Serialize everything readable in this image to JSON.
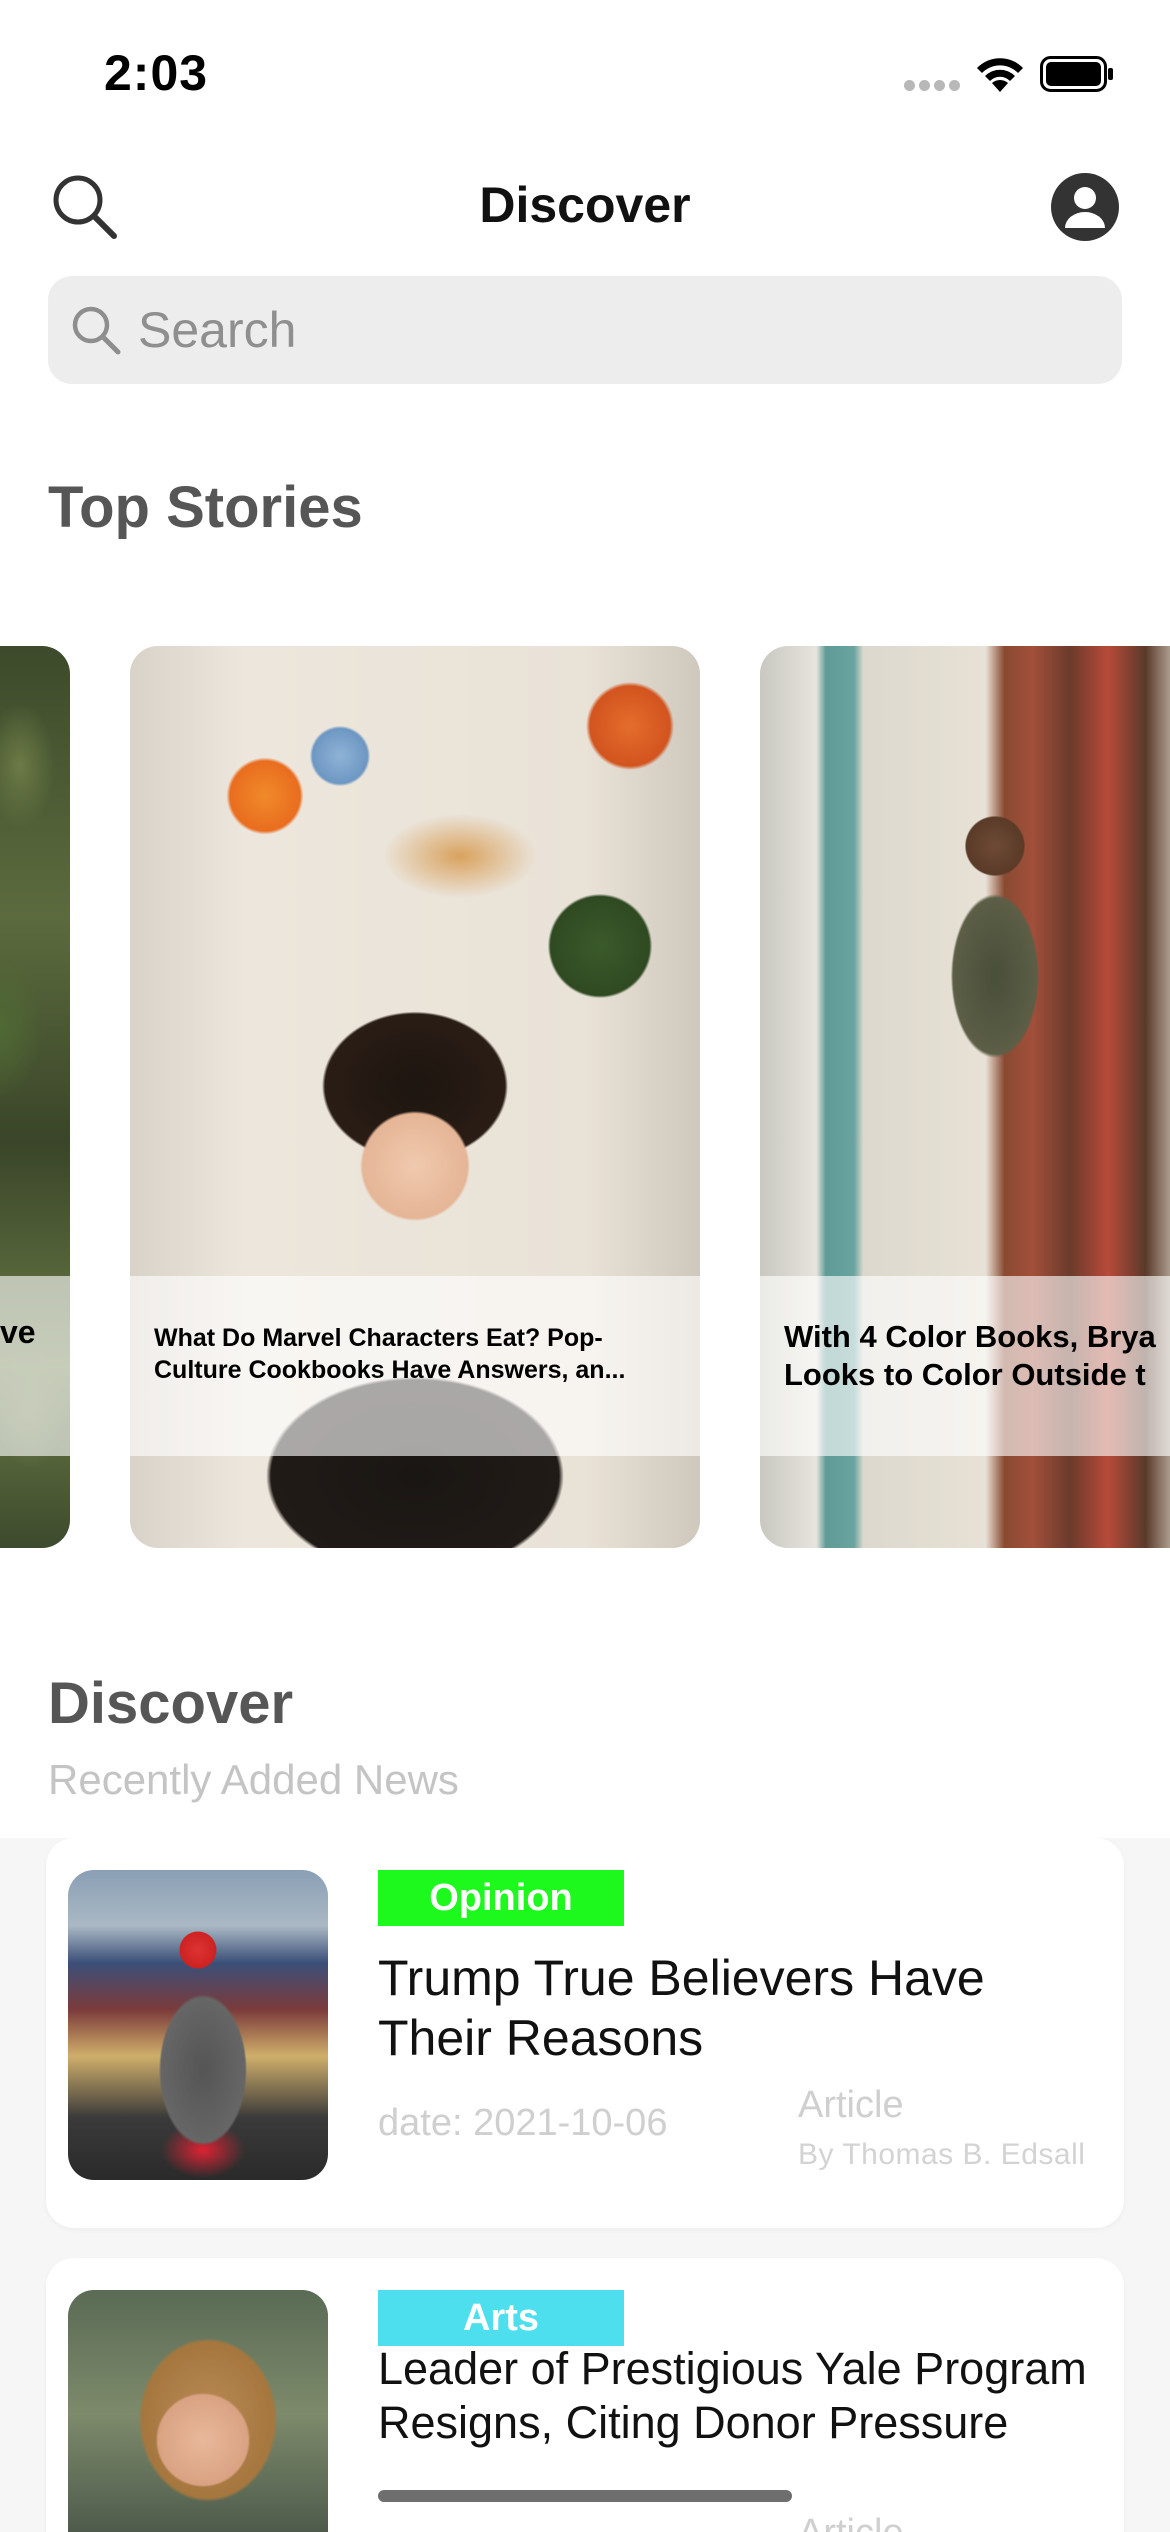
{
  "status_bar": {
    "time": "2:03"
  },
  "nav": {
    "title": "Discover",
    "icons": [
      "search-icon",
      "profile-icon"
    ]
  },
  "search": {
    "placeholder": "Search"
  },
  "top_stories": {
    "title": "Top Stories",
    "cards": [
      {
        "caption": "ve"
      },
      {
        "caption": "What Do Marvel Characters Eat? Pop-Culture Cookbooks Have Answers, an..."
      },
      {
        "caption": "With 4 Color Books, Brya Looks to Color Outside t"
      }
    ]
  },
  "discover": {
    "title": "Discover",
    "subtitle": "Recently Added News",
    "items": [
      {
        "tag": "Opinion",
        "tag_color": "#1df81d",
        "headline": "Trump True Believers Have Their Reasons",
        "date": "date: 2021-10-06",
        "type": "Article",
        "byline": "By Thomas B. Edsall"
      },
      {
        "tag": "Arts",
        "tag_color": "#4ddfee",
        "headline": "Leader of Prestigious Yale Program Resigns, Citing Donor Pressure",
        "type": "Article"
      }
    ]
  }
}
